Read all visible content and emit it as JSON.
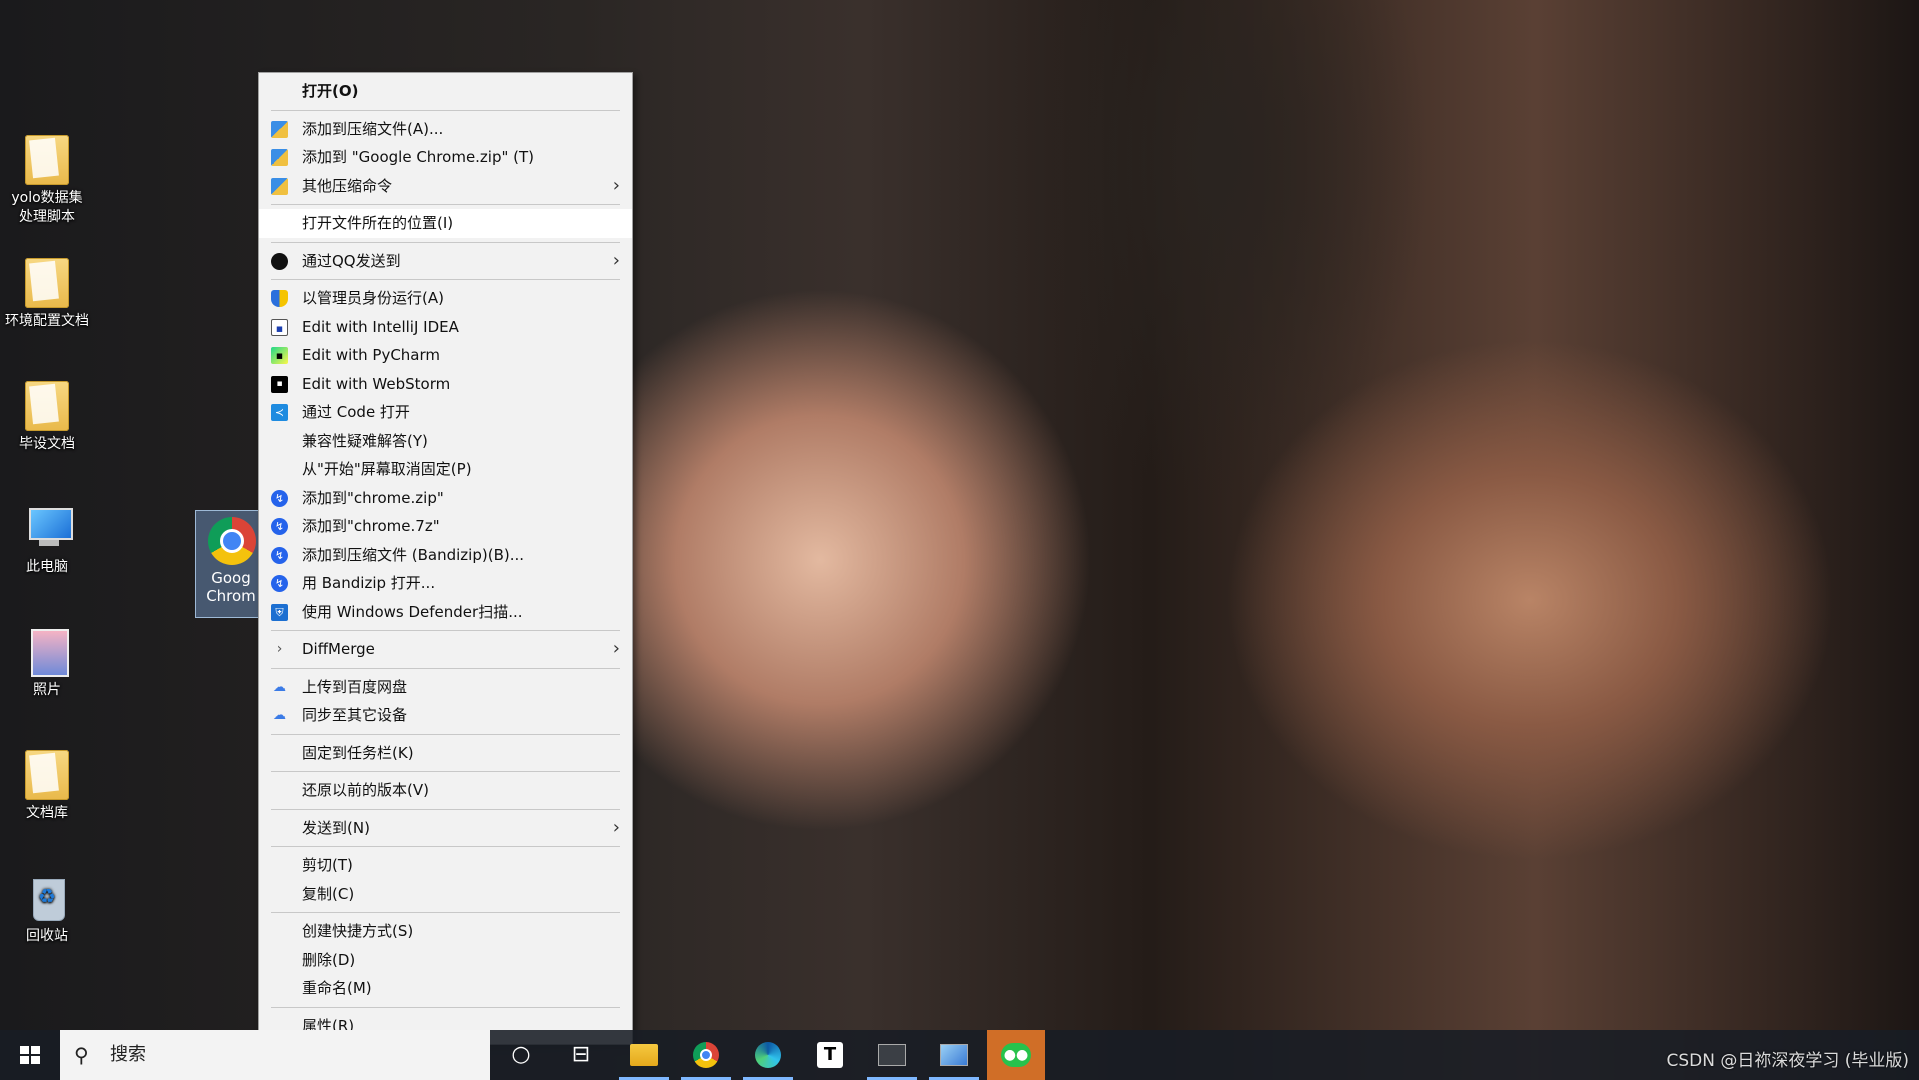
{
  "desktop": {
    "icons": [
      {
        "label_line1": "yolo数据集",
        "label_line2": "处理脚本",
        "icon": "folder-icon"
      },
      {
        "label_line1": "环境配置文档",
        "label_line2": "",
        "icon": "folder-icon"
      },
      {
        "label_line1": "毕设文档",
        "label_line2": "",
        "icon": "folder-icon"
      },
      {
        "label_line1": "此电脑",
        "label_line2": "",
        "icon": "computer-icon"
      },
      {
        "label_line1": "照片",
        "label_line2": "",
        "icon": "folder-icon"
      },
      {
        "label_line1": "文档库",
        "label_line2": "",
        "icon": "folder-icon"
      },
      {
        "label_line1": "回收站",
        "label_line2": "",
        "icon": "recycle-bin-icon"
      }
    ],
    "selected_icon": {
      "label_line1": "Goog",
      "label_line2": "Chrom",
      "icon": "chrome-icon"
    }
  },
  "context_menu": {
    "items": [
      {
        "label": "打开(O)"
      },
      {
        "label": "添加到压缩文件(A)..."
      },
      {
        "label": "添加到 \"Google Chrome.zip\" (T)"
      },
      {
        "label": "其他压缩命令"
      },
      {
        "label": "打开文件所在的位置(I)"
      },
      {
        "label": "通过QQ发送到"
      },
      {
        "label": "以管理员身份运行(A)"
      },
      {
        "label": "Edit with IntelliJ IDEA"
      },
      {
        "label": "Edit with PyCharm"
      },
      {
        "label": "Edit with WebStorm"
      },
      {
        "label": "通过 Code 打开"
      },
      {
        "label": "兼容性疑难解答(Y)"
      },
      {
        "label": "从\"开始\"屏幕取消固定(P)"
      },
      {
        "label": "添加到\"chrome.zip\""
      },
      {
        "label": "添加到\"chrome.7z\""
      },
      {
        "label": "添加到压缩文件 (Bandizip)(B)..."
      },
      {
        "label": "用 Bandizip 打开..."
      },
      {
        "label": "使用 Windows Defender扫描..."
      },
      {
        "label": "DiffMerge"
      },
      {
        "label": "上传到百度网盘"
      },
      {
        "label": "同步至其它设备"
      },
      {
        "label": "固定到任务栏(K)"
      },
      {
        "label": "还原以前的版本(V)"
      },
      {
        "label": "发送到(N)"
      },
      {
        "label": "剪切(T)"
      },
      {
        "label": "复制(C)"
      },
      {
        "label": "创建快捷方式(S)"
      },
      {
        "label": "删除(D)"
      },
      {
        "label": "重命名(M)"
      },
      {
        "label": "属性(R)"
      }
    ],
    "submenu_arrow": "›"
  },
  "taskbar": {
    "search_placeholder": "搜索",
    "search_icon": "⚲",
    "cortana_icon": "○",
    "taskview_icon": "⊟",
    "t_label": "T"
  },
  "watermark": "CSDN @日祢深夜学习 (毕业版)"
}
